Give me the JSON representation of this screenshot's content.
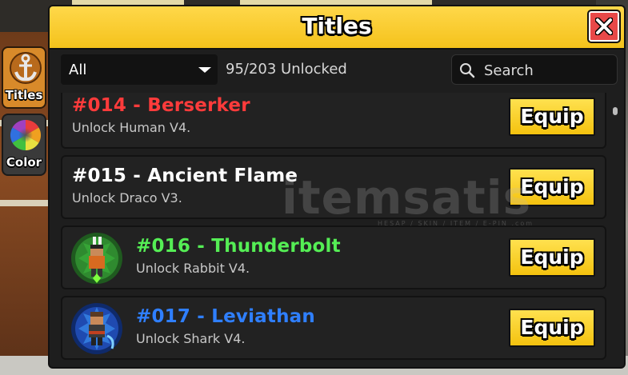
{
  "panel": {
    "title": "Titles",
    "close_icon": "close-x-icon"
  },
  "side_tabs": [
    {
      "label": "Titles",
      "icon": "anchor-icon"
    },
    {
      "label": "Color",
      "icon": "color-wheel-icon"
    }
  ],
  "toolbar": {
    "filter_value": "All",
    "unlock_count": "95/203 Unlocked",
    "search_placeholder": "Search"
  },
  "titles": [
    {
      "name": "#014 - Berserker",
      "requirement": "Unlock Human V4.",
      "color": "#ff3b3b",
      "has_avatar": false,
      "button": "Equip"
    },
    {
      "name": "#015 - Ancient Flame",
      "requirement": "Unlock Draco V3.",
      "color": "#ffffff",
      "has_avatar": false,
      "button": "Equip"
    },
    {
      "name": "#016 - Thunderbolt",
      "requirement": "Unlock Rabbit V4.",
      "color": "#55ee55",
      "has_avatar": true,
      "avatar_icon": "rabbit-avatar-icon",
      "button": "Equip"
    },
    {
      "name": "#017 - Leviathan",
      "requirement": "Unlock Shark V4.",
      "color": "#2f7fff",
      "has_avatar": true,
      "avatar_icon": "shark-avatar-icon",
      "button": "Equip"
    }
  ],
  "watermark": {
    "main": "itemsatis",
    "sub": "HESAP / SKIN / ITEM / E-PIN .com"
  },
  "colors": {
    "header_yellow": "#f4c21b",
    "equip_yellow": "#ffd83a",
    "close_red": "#e84848",
    "panel_bg": "#1e1e1e"
  }
}
